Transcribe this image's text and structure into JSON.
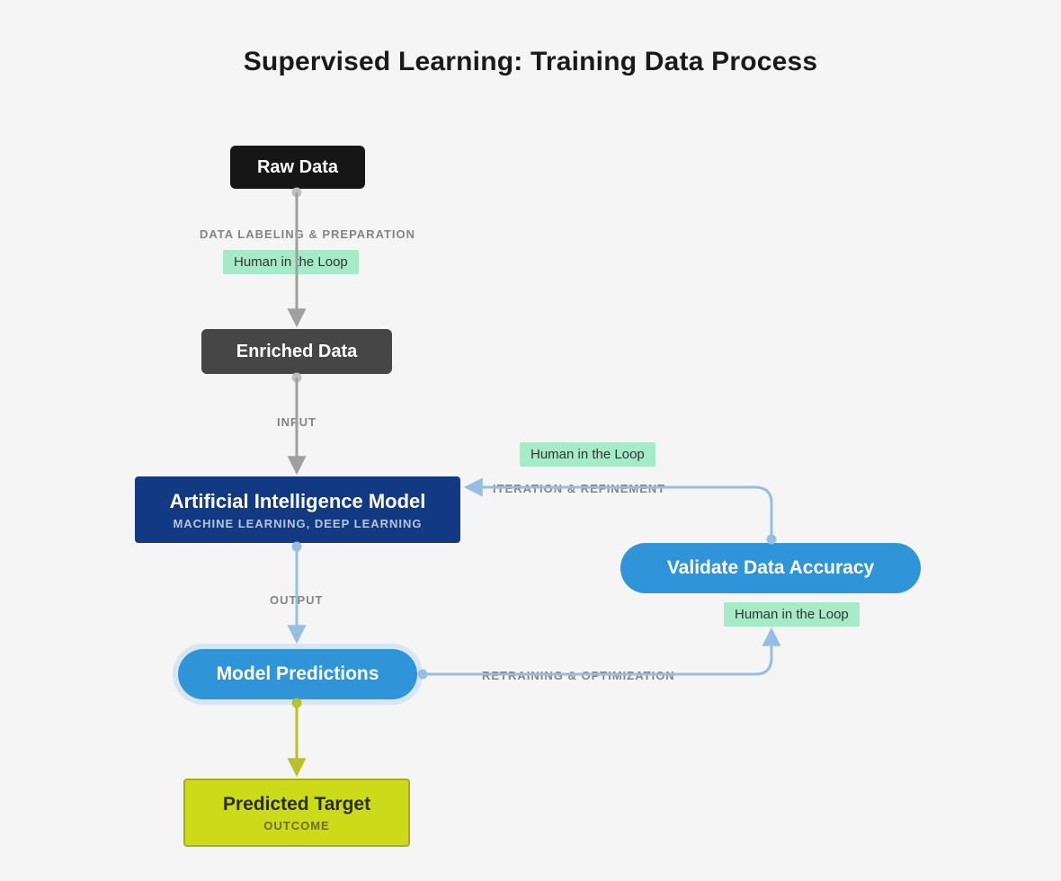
{
  "title": "Supervised Learning: Training Data Process",
  "nodes": {
    "raw_data": "Raw Data",
    "enriched_data": "Enriched Data",
    "ai_model": {
      "line1": "Artificial Intelligence Model",
      "line2": "MACHINE LEARNING, DEEP LEARNING"
    },
    "model_predictions": "Model Predictions",
    "predicted_target": {
      "line1": "Predicted Target",
      "line2": "OUTCOME"
    },
    "validate": "Validate Data Accuracy"
  },
  "tags": {
    "human_in_the_loop": "Human in the Loop"
  },
  "edges": {
    "prep": "DATA LABELING & PREPARATION",
    "input": "INPUT",
    "output": "OUTPUT",
    "iteration": "ITERATION & REFINEMENT",
    "retraining": "RETRAINING & OPTIMIZATION"
  },
  "colors": {
    "background": "#f5f5f5",
    "raw_data": "#161616",
    "enriched_data": "#464646",
    "ai_model": "#123a82",
    "blue_pill": "#2f94d8",
    "predicted_bg": "#cbda19",
    "predicted_border": "#a5ac23",
    "hitl_bg": "#a6ebc8",
    "edge_gray": "#9f9f9f",
    "edge_blue": "#97bee2",
    "edge_yellow": "#b8c228"
  }
}
